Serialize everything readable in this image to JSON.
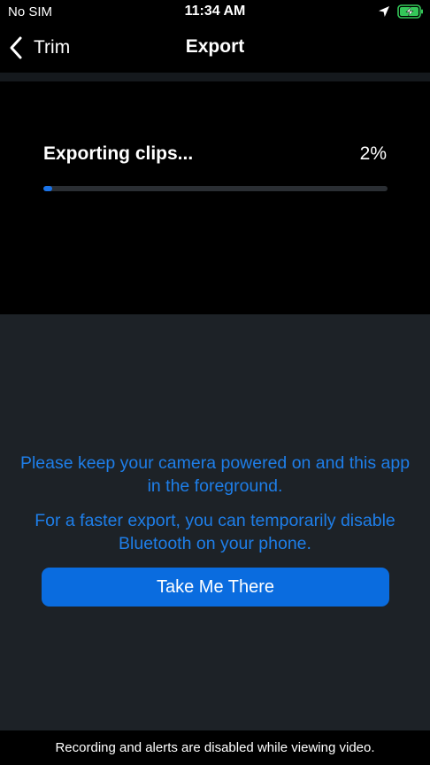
{
  "status_bar": {
    "carrier": "No SIM",
    "time": "11:34 AM",
    "location_icon": "location-arrow-icon",
    "battery_icon": "battery-charging-icon",
    "battery_color": "#34c759"
  },
  "nav": {
    "back_icon": "chevron-left-icon",
    "back_label": "Trim",
    "title": "Export"
  },
  "export": {
    "label": "Exporting clips...",
    "percent_text": "2%",
    "progress_fraction": 0.02,
    "progress_color": "#1a73e8"
  },
  "info": {
    "message_1": "Please keep your camera powered on and this app in the foreground.",
    "message_2": "For a faster export, you can temporarily disable Bluetooth on your phone.",
    "button_label": "Take Me There",
    "accent_color": "#1e7ee8"
  },
  "footer": {
    "text": "Recording and alerts are disabled while viewing video."
  }
}
